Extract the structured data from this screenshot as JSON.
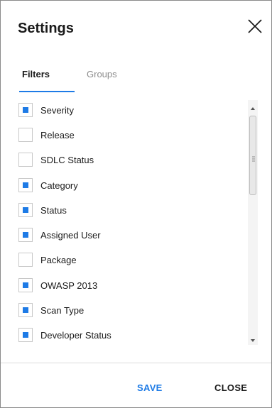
{
  "dialog": {
    "title": "Settings",
    "close_icon": "close-icon"
  },
  "tabs": [
    {
      "label": "Filters",
      "active": true
    },
    {
      "label": "Groups",
      "active": false
    }
  ],
  "items": [
    {
      "label": "Severity",
      "checked": true
    },
    {
      "label": "Release",
      "checked": false
    },
    {
      "label": "SDLC Status",
      "checked": false
    },
    {
      "label": "Category",
      "checked": true
    },
    {
      "label": "Status",
      "checked": true
    },
    {
      "label": "Assigned User",
      "checked": true
    },
    {
      "label": "Package",
      "checked": false
    },
    {
      "label": "OWASP 2013",
      "checked": true
    },
    {
      "label": "Scan Type",
      "checked": true
    },
    {
      "label": "Developer Status",
      "checked": true
    }
  ],
  "footer": {
    "save_label": "SAVE",
    "close_label": "CLOSE"
  },
  "colors": {
    "accent": "#1e7be6",
    "text": "#1a1a1a",
    "muted": "#8c8c8c"
  }
}
